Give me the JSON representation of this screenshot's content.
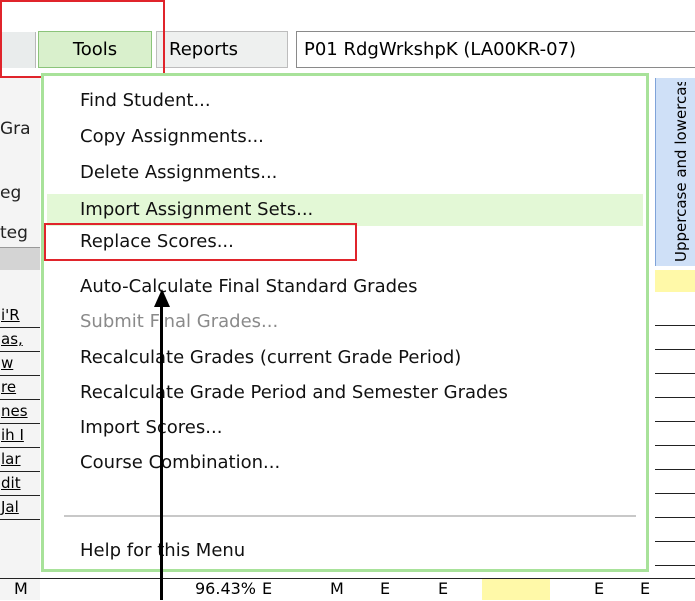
{
  "menubar": {
    "tools_label": "Tools",
    "reports_label": "Reports",
    "course_label": "P01  RdgWrkshpK (LA00KR-07)"
  },
  "grid": {
    "header_labels": [
      "Gra",
      "eg",
      "teg"
    ],
    "row_labels": [
      "i'R",
      "as,",
      "w",
      "re",
      "nes",
      "ih I",
      "lar",
      "dit",
      "Jal"
    ],
    "standard_header": "Uppercase and lowercase",
    "bottom_row": [
      "M",
      "96.43%",
      "E",
      "M",
      "E",
      "E",
      "E",
      "E"
    ]
  },
  "tools_menu": {
    "items": [
      {
        "label": "Find Student...",
        "enabled": true
      },
      {
        "label": "Copy Assignments...",
        "enabled": true
      },
      {
        "label": "Delete Assignments...",
        "enabled": true
      },
      {
        "label": "Import Assignment Sets...",
        "enabled": true,
        "highlighted": true
      },
      {
        "label": "Replace Scores...",
        "enabled": true
      },
      {
        "label": "Auto-Calculate Final Standard Grades",
        "enabled": true
      },
      {
        "label": "Submit Final Grades...",
        "enabled": false
      },
      {
        "label": "Recalculate Grades (current Grade Period)",
        "enabled": true
      },
      {
        "label": "Recalculate Grade Period and Semester Grades",
        "enabled": true
      },
      {
        "label": "Import Scores...",
        "enabled": true
      },
      {
        "label": "Course Combination...",
        "enabled": true
      },
      {
        "label": "Help for this Menu",
        "enabled": true
      }
    ]
  },
  "colors": {
    "menu_border": "#a8e29a",
    "menu_hover": "#e3f8d6",
    "annotation_red": "#e0242b",
    "standard_header_blue": "#cfe0f7",
    "score_yellow": "#fff9a8"
  }
}
